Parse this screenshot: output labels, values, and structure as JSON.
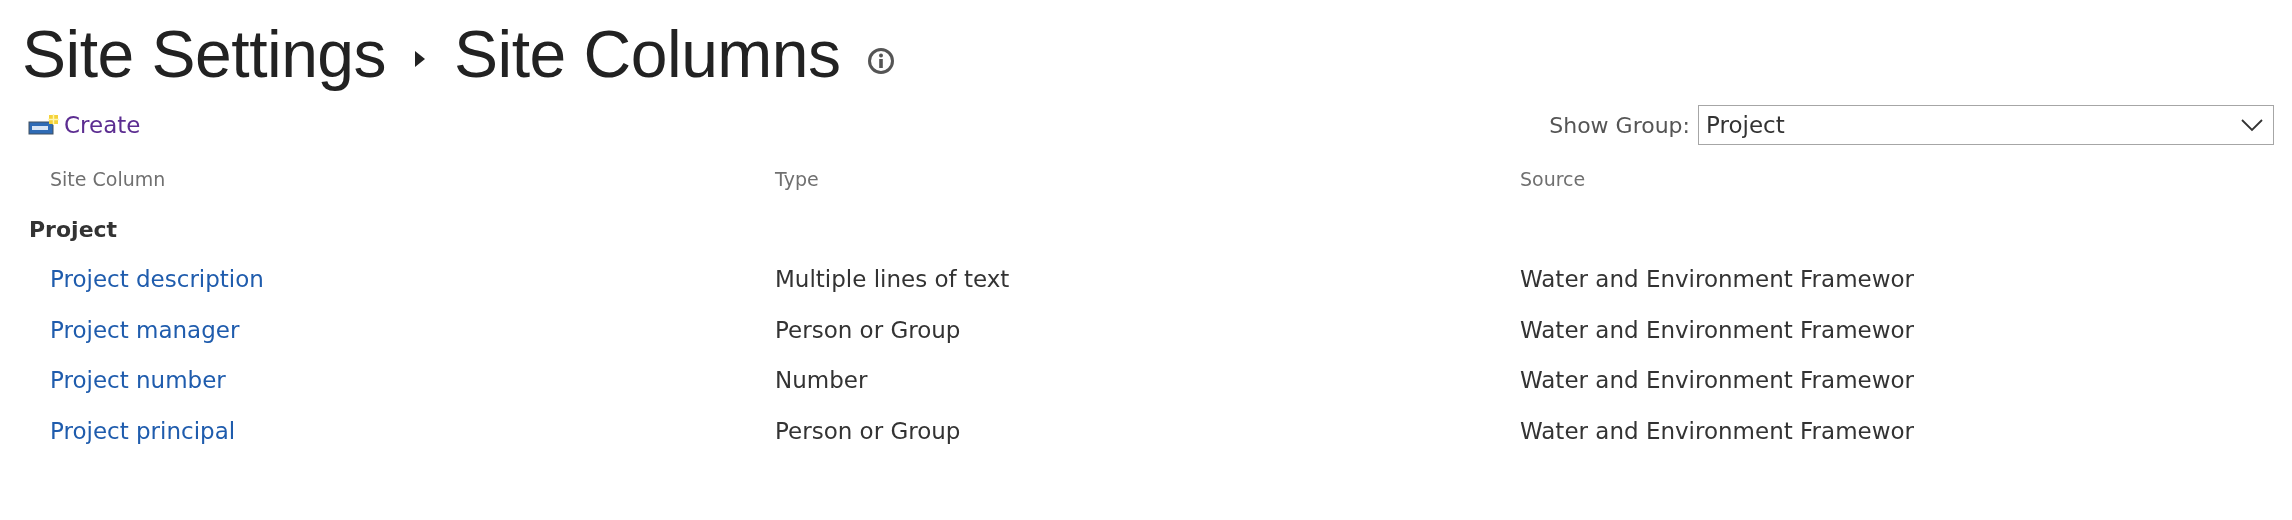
{
  "breadcrumb": [
    "Site Settings",
    "Site Columns"
  ],
  "toolbar": {
    "create_link": "Create",
    "show_group": {
      "label": "Show Group:",
      "value": "Project"
    }
  },
  "table": {
    "columns": [
      "Site Column",
      "Type",
      "Source"
    ],
    "groups": [
      {
        "name": "Project",
        "rows": [
          {
            "cells": [
              "Project description",
              "Multiple lines of text",
              "Water and Environment Framewor"
            ]
          },
          {
            "cells": [
              "Project manager",
              "Person or Group",
              "Water and Environment Framewor"
            ]
          },
          {
            "cells": [
              "Project number",
              "Number",
              "Water and Environment Framewor"
            ]
          },
          {
            "cells": [
              "Project principal",
              "Person or Group",
              "Water and Environment Framewor"
            ]
          }
        ]
      }
    ]
  }
}
